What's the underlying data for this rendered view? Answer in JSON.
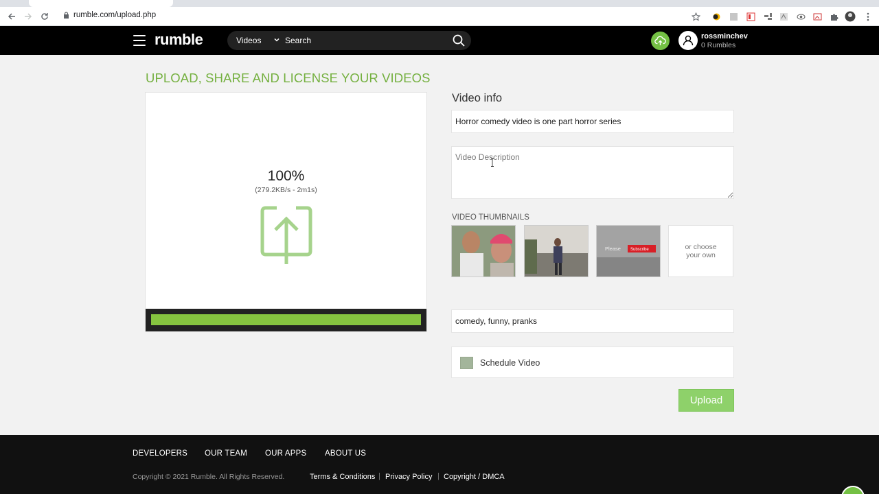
{
  "browser": {
    "url": "rumble.com/upload.php"
  },
  "header": {
    "logo": "rumble",
    "search_category": "Videos",
    "search_placeholder": "Search",
    "username": "rossminchev",
    "rumbles": "0 Rumbles"
  },
  "main": {
    "heading": "UPLOAD, SHARE AND LICENSE YOUR VIDEOS",
    "progress": {
      "percent_label": "100%",
      "speed_label": "(279.2KB/s - 2m1s)",
      "fraction": 1.0
    },
    "form": {
      "section_title": "Video info",
      "title_value": "Horror comedy video is one part horror series",
      "description_placeholder": "Video Description",
      "thumbnails_label": "VIDEO THUMBNAILS",
      "thumb3_please": "Please",
      "thumb3_subscribe": "Subscribe",
      "choose_own": "or choose your own",
      "tags_value": "comedy, funny, pranks",
      "schedule_label": "Schedule Video",
      "upload_label": "Upload"
    }
  },
  "footer": {
    "nav": [
      "DEVELOPERS",
      "OUR TEAM",
      "OUR APPS",
      "ABOUT US"
    ],
    "copyright": "Copyright © 2021 Rumble. All Rights Reserved.",
    "legal": [
      "Terms & Conditions",
      "Privacy Policy",
      "Copyright / DMCA"
    ]
  },
  "colors": {
    "brand_green": "#74b03f",
    "progress_green": "#86c440",
    "header_black": "#000000"
  }
}
